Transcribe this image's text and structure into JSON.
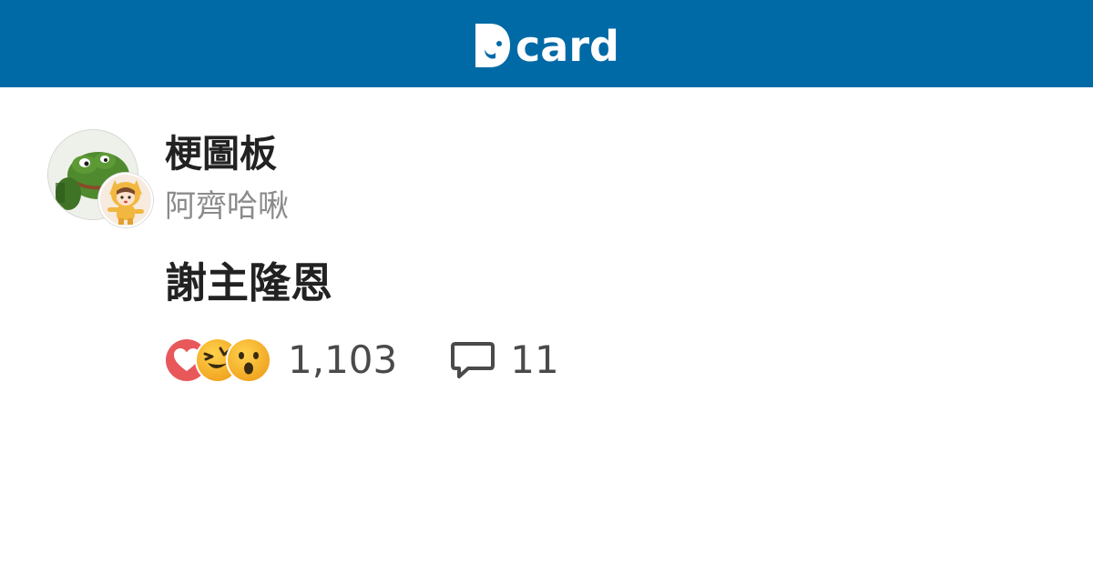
{
  "header": {
    "brand": "card",
    "background_color": "#006aa6",
    "logo_icon": "dcard-d-icon"
  },
  "post": {
    "forum_name": "梗圖板",
    "author_name": "阿齊哈啾",
    "title": "謝主隆恩",
    "forum_avatar": "frog-avatar",
    "author_avatar": "anime-girl-avatar"
  },
  "reactions": {
    "icons": [
      "heart-reaction-icon",
      "laughing-reaction-icon",
      "surprised-reaction-icon"
    ],
    "count": "1,103"
  },
  "comments": {
    "icon": "comment-bubble-icon",
    "count": "11"
  },
  "colors": {
    "heart": "#e8585b",
    "emoji_yellow": "#f7b632",
    "text_primary": "#222222",
    "text_secondary": "#8b8b8b"
  }
}
